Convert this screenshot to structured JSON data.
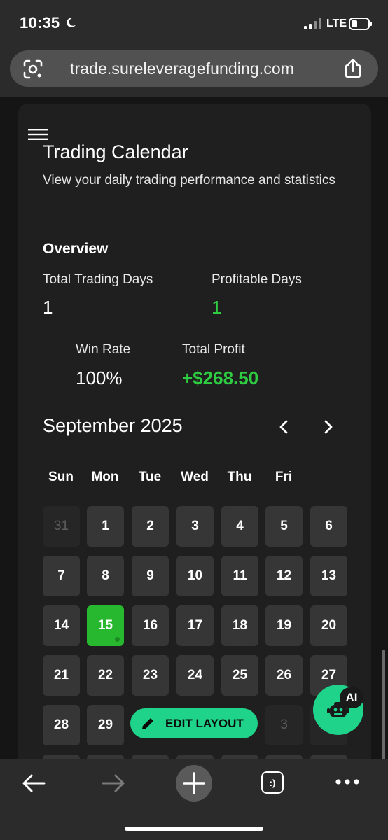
{
  "status": {
    "time": "10:35",
    "network": "LTE"
  },
  "browser": {
    "url": "trade.sureleveragefunding.com",
    "tab_icon": ":)"
  },
  "page": {
    "title": "Trading Calendar",
    "subtitle": "View your daily trading performance and statistics",
    "overview": {
      "title": "Overview",
      "total_days_label": "Total Trading Days",
      "total_days_value": "1",
      "profitable_days_label": "Profitable Days",
      "profitable_days_value": "1",
      "win_rate_label": "Win Rate",
      "win_rate_value": "100%",
      "total_profit_label": "Total Profit",
      "total_profit_value": "+$268.50"
    },
    "calendar": {
      "month": "September 2025",
      "weekdays": [
        "Sun",
        "Mon",
        "Tue",
        "Wed",
        "Thu",
        "Fri"
      ],
      "rows": [
        [
          "31",
          "1",
          "2",
          "3",
          "4",
          "5",
          "6"
        ],
        [
          "7",
          "8",
          "9",
          "10",
          "11",
          "12",
          "13"
        ],
        [
          "14",
          "15",
          "16",
          "17",
          "18",
          "19",
          "20"
        ],
        [
          "21",
          "22",
          "23",
          "24",
          "25",
          "26",
          "27"
        ],
        [
          "28",
          "29",
          "3"
        ]
      ],
      "highlight_day": "15"
    }
  },
  "edit_layout_label": "EDIT LAYOUT",
  "ai_badge": "AI",
  "colors": {
    "accent": "#1fd38b",
    "profit": "#2ecc40",
    "today": "#28b830"
  }
}
